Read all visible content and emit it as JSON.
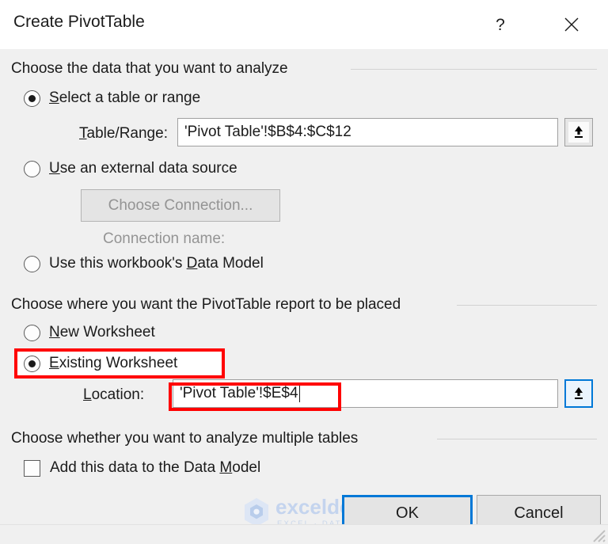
{
  "window": {
    "title": "Create PivotTable",
    "help_icon": "question-mark-icon",
    "close_icon": "close-x-icon"
  },
  "section_analyze": {
    "header": "Choose the data that you want to analyze",
    "option_select_range": {
      "label_before": "S",
      "label_accel": "S",
      "label": "Select a table or range",
      "selected": true
    },
    "table_range": {
      "label": "Table/Range:",
      "value": "'Pivot Table'!$B$4:$C$12",
      "picker_icon": "collapse-dialog-icon"
    },
    "option_external": {
      "label": "Use an external data source",
      "selected": false
    },
    "choose_connection_button": "Choose Connection...",
    "connection_name_label": "Connection name:",
    "option_data_model": {
      "label": "Use this workbook's Data Model",
      "selected": false
    }
  },
  "section_placement": {
    "header": "Choose where you want the PivotTable report to be placed",
    "option_new_worksheet": {
      "label": "New Worksheet",
      "selected": false
    },
    "option_existing_worksheet": {
      "label": "Existing Worksheet",
      "selected": true,
      "highlighted": true
    },
    "location": {
      "label": "Location:",
      "value": "'Pivot Table'!$E$4",
      "highlighted": true,
      "picker_icon": "collapse-dialog-icon"
    }
  },
  "section_multiple_tables": {
    "header": "Choose whether you want to analyze multiple tables",
    "option_add_to_data_model": {
      "label": "Add this data to the Data Model",
      "checked": false
    }
  },
  "footer": {
    "ok_label": "OK",
    "ok_focused": true,
    "cancel_label": "Cancel",
    "resize_grip_icon": "resize-grip-icon"
  },
  "watermark": {
    "brand": "exceldemy",
    "tagline": "EXCEL · DATA · BI",
    "logo_icon": "hexagon-logo-icon"
  },
  "colors": {
    "accent_blue": "#0078d7",
    "highlight_red": "#ff0000",
    "dialog_bg": "#f0f0f0",
    "titlebar_bg": "#ffffff",
    "disabled_text": "#949494"
  }
}
